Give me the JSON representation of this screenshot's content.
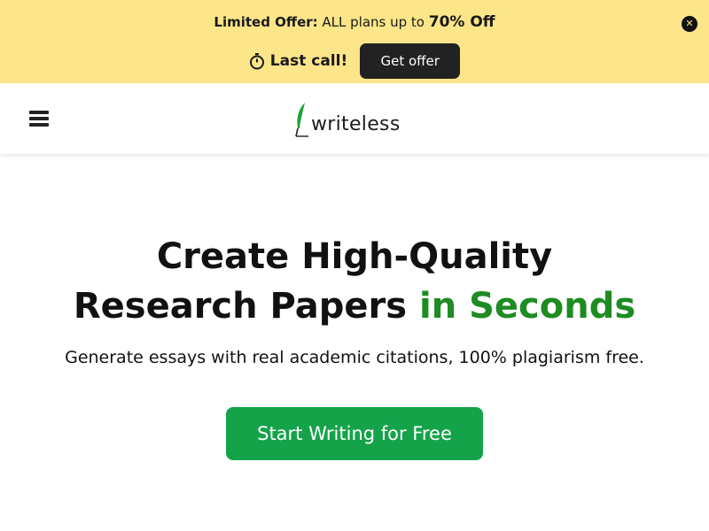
{
  "promo": {
    "limited_offer": "Limited Offer:",
    "all_plans": " ALL plans up to ",
    "discount": "70% Off",
    "last_call": "Last call!",
    "offer_button": "Get offer",
    "close_glyph": "✕"
  },
  "header": {
    "logo_text": "writeless"
  },
  "hero": {
    "title_line1": "Create High-Quality",
    "title_line2": "Research Papers ",
    "title_accent": "in Seconds",
    "subtitle": "Generate essays with real academic citations, 100% plagiarism free.",
    "cta": "Start Writing for Free"
  },
  "colors": {
    "promo_bg": "#fde589",
    "accent_green": "#1e8c22",
    "cta_green": "#15a34a",
    "dark": "#222222"
  },
  "icons": [
    "close-icon",
    "stopwatch-icon",
    "menu-icon",
    "quill-icon"
  ]
}
